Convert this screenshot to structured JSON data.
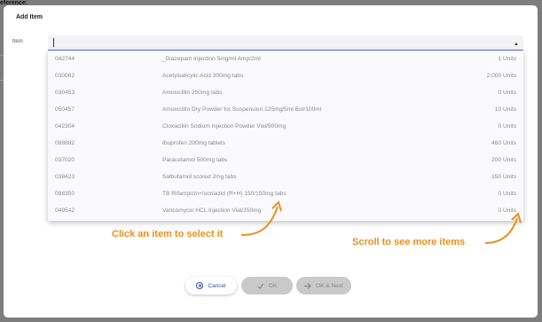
{
  "backdrop": {
    "reference_label": "eference:"
  },
  "modal": {
    "title": "Add Item",
    "item_label": "Item",
    "combo_value": "",
    "arrow_glyph": "▲"
  },
  "items": [
    {
      "code": "042744",
      "description": "_Diazepam Injection 5mg/ml Amp/2ml",
      "quantity": "1 Units"
    },
    {
      "code": "030062",
      "description": "Acetylsalicylic Acid 300mg tabs",
      "quantity": "2,000 Units"
    },
    {
      "code": "030453",
      "description": "Amoxicillin 250mg tabs",
      "quantity": "0 Units"
    },
    {
      "code": "050457",
      "description": "Amoxicillin Dry Powder for Suspension 125mg/5ml Bot/100ml",
      "quantity": "10 Units"
    },
    {
      "code": "042304",
      "description": "Cloxacillin Sodium Injection Powder Vial/500mg",
      "quantity": "0 Units"
    },
    {
      "code": "088882",
      "description": "Ibuprofen 200mg tablets",
      "quantity": "460 Units"
    },
    {
      "code": "037020",
      "description": "Paracetamol 500mg tabs",
      "quantity": "200 Units"
    },
    {
      "code": "038423",
      "description": "Salbutamol scored 2mg tabs",
      "quantity": "150 Units"
    },
    {
      "code": "098350",
      "description": "TB Rifampicin+Isoniazid (R+H) 150/150mg tabs",
      "quantity": "0 Units"
    },
    {
      "code": "049542",
      "description": "Vancomycin HCL Injection Vial/250mg",
      "quantity": "0 Units"
    }
  ],
  "annotations": {
    "click_hint": "Click an item to select it",
    "scroll_hint": "Scroll to see more items",
    "color": "#e8901e"
  },
  "buttons": {
    "cancel": "Cancel",
    "ok": "OK",
    "ok_next": "OK & Next"
  },
  "icons": {
    "cancel": "circle-x-icon",
    "ok": "check-icon",
    "ok_next": "arrow-right-icon"
  }
}
